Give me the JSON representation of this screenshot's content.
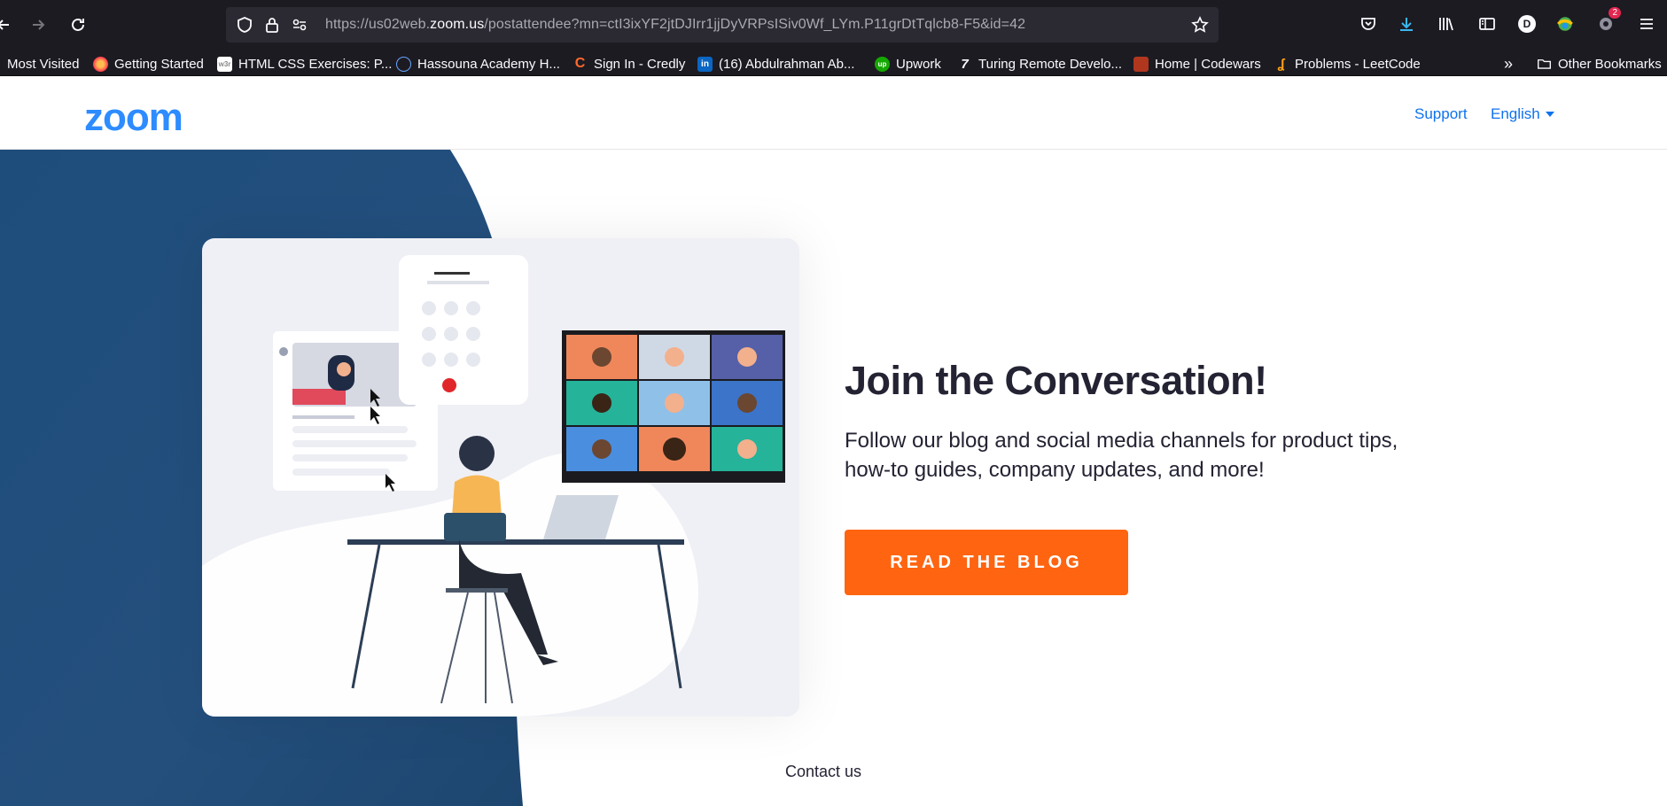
{
  "browser": {
    "url_prefix": "https://us02web.",
    "url_domain": "zoom.us",
    "url_path": "/postattendee?mn=ctI3ixYF2jtDJIrr1jjDyVRPsISiv0Wf_LYm.P11grDtTqlcb8-F5&id=42",
    "profile_initial": "D",
    "extensions_badge": "2"
  },
  "bookmarks": [
    {
      "label": "Most Visited",
      "icon": "gear-icon"
    },
    {
      "label": "Getting Started",
      "icon": "firefox-icon"
    },
    {
      "label": "HTML CSS Exercises: P...",
      "icon": "w3r-icon"
    },
    {
      "label": "Hassouna Academy H...",
      "icon": "globe-icon"
    },
    {
      "label": "Sign In - Credly",
      "icon": "credly-icon"
    },
    {
      "label": "(16) Abdulrahman Ab...",
      "icon": "linkedin-icon"
    },
    {
      "label": "Upwork",
      "icon": "upwork-icon"
    },
    {
      "label": "Turing Remote Develo...",
      "icon": "turing-icon"
    },
    {
      "label": "Home | Codewars",
      "icon": "codewars-icon"
    },
    {
      "label": "Problems - LeetCode",
      "icon": "leetcode-icon"
    }
  ],
  "other_bookmarks": "Other Bookmarks",
  "header": {
    "logo": "zoom",
    "support": "Support",
    "language": "English"
  },
  "hero": {
    "title": "Join the Conversation!",
    "subtitle": "Follow our blog and social media channels for product tips, how-to guides, company updates, and more!",
    "cta": "READ THE BLOG"
  },
  "footer": {
    "contact": "Contact us"
  },
  "colors": {
    "accent": "#0e72ed",
    "cta": "#ff6411",
    "wave": "#1f4f7f"
  }
}
